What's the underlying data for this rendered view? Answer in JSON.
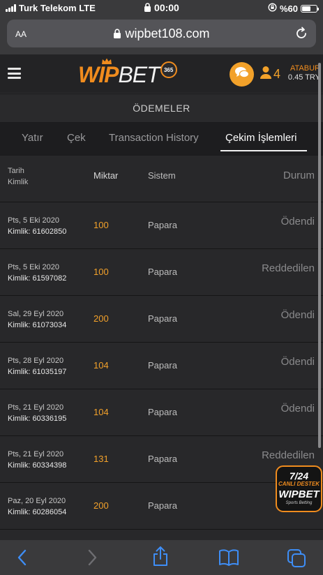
{
  "status_bar": {
    "carrier": "Turk Telekom  LTE",
    "time": "00:00",
    "battery": "%60",
    "battery_level": 0.6
  },
  "browser": {
    "text_size_label": "AA",
    "url": "wipbet108.com"
  },
  "header": {
    "logo_wip": "WIP",
    "logo_bet": "BET",
    "logo_badge": "365",
    "user_count": "4",
    "user_name": "ATABUR",
    "balance": "0.45 TRY"
  },
  "page_title": "ÖDEMELER",
  "tabs": [
    {
      "label": "Yatır",
      "active": false
    },
    {
      "label": "Çek",
      "active": false
    },
    {
      "label": "Transaction History",
      "active": false
    },
    {
      "label": "Çekim İşlemleri",
      "active": true
    }
  ],
  "table": {
    "headers": {
      "date": "Tarih",
      "id": "Kimlik",
      "amount": "Miktar",
      "system": "Sistem",
      "status": "Durum"
    },
    "rows": [
      {
        "date": "Pts, 5 Eki 2020",
        "id": "Kimlik: 61602850",
        "amount": "100",
        "system": "Papara",
        "status": "Ödendi"
      },
      {
        "date": "Pts, 5 Eki 2020",
        "id": "Kimlik: 61597082",
        "amount": "100",
        "system": "Papara",
        "status": "Reddedilen"
      },
      {
        "date": "Sal, 29 Eyl 2020",
        "id": "Kimlik: 61073034",
        "amount": "200",
        "system": "Papara",
        "status": "Ödendi"
      },
      {
        "date": "Pts, 28 Eyl 2020",
        "id": "Kimlik: 61035197",
        "amount": "104",
        "system": "Papara",
        "status": "Ödendi"
      },
      {
        "date": "Pts, 21 Eyl 2020",
        "id": "Kimlik: 60336195",
        "amount": "104",
        "system": "Papara",
        "status": "Ödendi"
      },
      {
        "date": "Pts, 21 Eyl 2020",
        "id": "Kimlik: 60334398",
        "amount": "131",
        "system": "Papara",
        "status": "Reddedilen"
      },
      {
        "date": "Paz, 20 Eyl 2020",
        "id": "Kimlik: 60286054",
        "amount": "200",
        "system": "Papara",
        "status": ""
      }
    ]
  },
  "support": {
    "line1": "7/24",
    "line2": "CANLI DESTEK",
    "line3": "WIPBET",
    "line4": "Sports Betting"
  },
  "colors": {
    "accent": "#f08c1e",
    "amount": "#f2a12a",
    "background": "#1b1b1d",
    "row": "#28282a"
  }
}
